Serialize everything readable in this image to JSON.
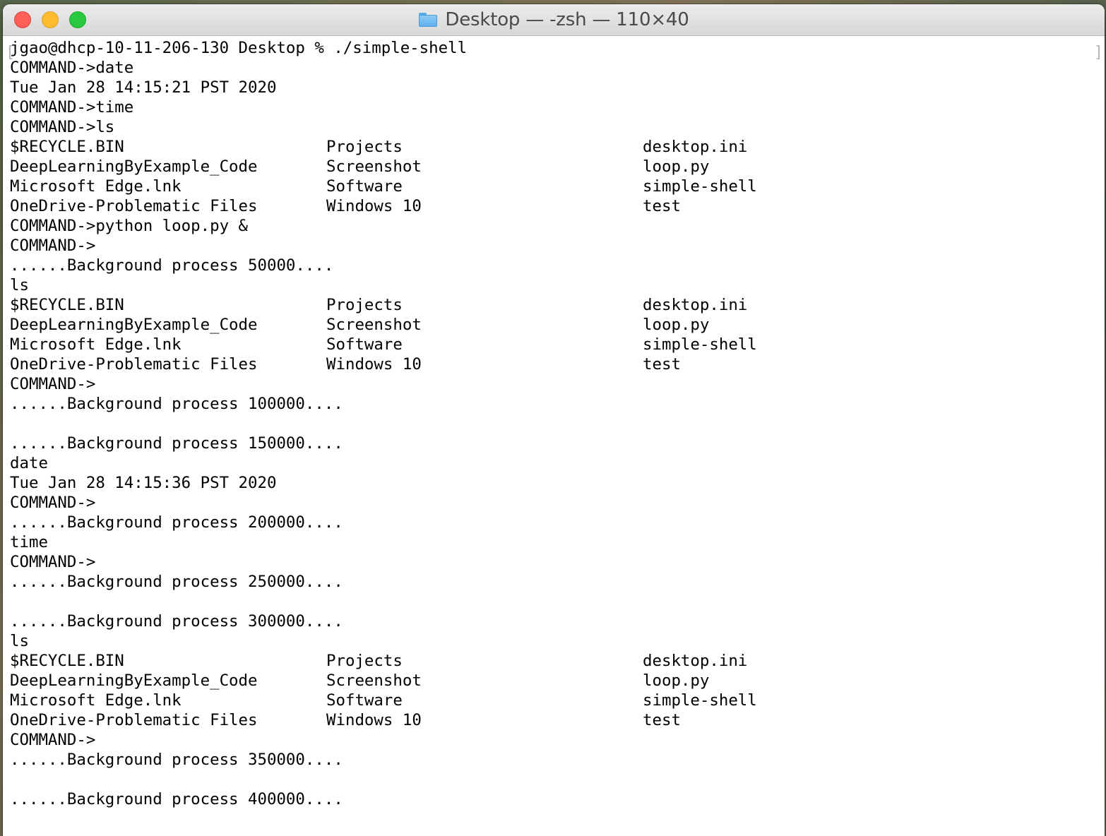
{
  "window": {
    "title": "Desktop — -zsh — 110×40",
    "folder_icon": "folder-icon"
  },
  "terminal": {
    "lines": [
      {
        "type": "text",
        "text": "jgao@dhcp-10-11-206-130 Desktop % ./simple-shell"
      },
      {
        "type": "text",
        "text": "COMMAND->date"
      },
      {
        "type": "text",
        "text": "Tue Jan 28 14:15:21 PST 2020"
      },
      {
        "type": "text",
        "text": "COMMAND->time"
      },
      {
        "type": "text",
        "text": "COMMAND->ls"
      },
      {
        "type": "ls",
        "cols": [
          "$RECYCLE.BIN",
          "Projects",
          "desktop.ini"
        ]
      },
      {
        "type": "ls",
        "cols": [
          "DeepLearningByExample_Code",
          "Screenshot",
          "loop.py"
        ]
      },
      {
        "type": "ls",
        "cols": [
          "Microsoft Edge.lnk",
          "Software",
          "simple-shell"
        ]
      },
      {
        "type": "ls",
        "cols": [
          "OneDrive-Problematic Files",
          "Windows 10",
          "test"
        ]
      },
      {
        "type": "text",
        "text": "COMMAND->python loop.py &"
      },
      {
        "type": "text",
        "text": "COMMAND->"
      },
      {
        "type": "text",
        "text": "......Background process 50000...."
      },
      {
        "type": "text",
        "text": "ls"
      },
      {
        "type": "ls",
        "cols": [
          "$RECYCLE.BIN",
          "Projects",
          "desktop.ini"
        ]
      },
      {
        "type": "ls",
        "cols": [
          "DeepLearningByExample_Code",
          "Screenshot",
          "loop.py"
        ]
      },
      {
        "type": "ls",
        "cols": [
          "Microsoft Edge.lnk",
          "Software",
          "simple-shell"
        ]
      },
      {
        "type": "ls",
        "cols": [
          "OneDrive-Problematic Files",
          "Windows 10",
          "test"
        ]
      },
      {
        "type": "text",
        "text": "COMMAND->"
      },
      {
        "type": "text",
        "text": "......Background process 100000...."
      },
      {
        "type": "text",
        "text": ""
      },
      {
        "type": "text",
        "text": "......Background process 150000...."
      },
      {
        "type": "text",
        "text": "date"
      },
      {
        "type": "text",
        "text": "Tue Jan 28 14:15:36 PST 2020"
      },
      {
        "type": "text",
        "text": "COMMAND->"
      },
      {
        "type": "text",
        "text": "......Background process 200000...."
      },
      {
        "type": "text",
        "text": "time"
      },
      {
        "type": "text",
        "text": "COMMAND->"
      },
      {
        "type": "text",
        "text": "......Background process 250000...."
      },
      {
        "type": "text",
        "text": ""
      },
      {
        "type": "text",
        "text": "......Background process 300000...."
      },
      {
        "type": "text",
        "text": "ls"
      },
      {
        "type": "ls",
        "cols": [
          "$RECYCLE.BIN",
          "Projects",
          "desktop.ini"
        ]
      },
      {
        "type": "ls",
        "cols": [
          "DeepLearningByExample_Code",
          "Screenshot",
          "loop.py"
        ]
      },
      {
        "type": "ls",
        "cols": [
          "Microsoft Edge.lnk",
          "Software",
          "simple-shell"
        ]
      },
      {
        "type": "ls",
        "cols": [
          "OneDrive-Problematic Files",
          "Windows 10",
          "test"
        ]
      },
      {
        "type": "text",
        "text": "COMMAND->"
      },
      {
        "type": "text",
        "text": "......Background process 350000...."
      },
      {
        "type": "text",
        "text": ""
      },
      {
        "type": "text",
        "text": "......Background process 400000...."
      }
    ]
  }
}
